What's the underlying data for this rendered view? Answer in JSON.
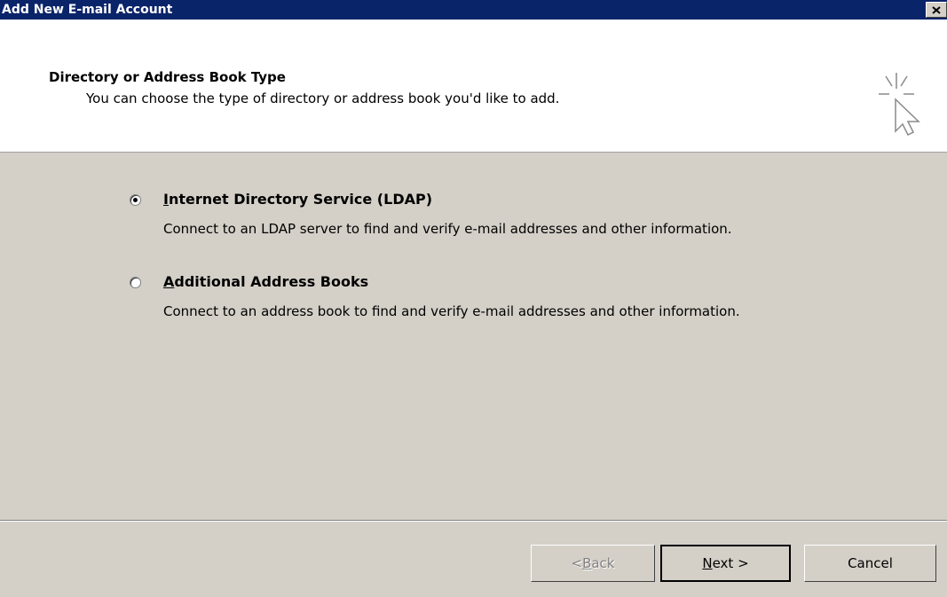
{
  "window": {
    "title": "Add New E-mail Account"
  },
  "header": {
    "title": "Directory or Address Book Type",
    "subtitle": "You can choose the type of directory or address book you'd like to add."
  },
  "options": [
    {
      "mnemonic": "I",
      "label_rest": "nternet Directory Service (LDAP)",
      "description": "Connect to an LDAP server to find and verify e-mail addresses and other information.",
      "selected": true
    },
    {
      "mnemonic": "A",
      "label_rest": "dditional Address Books",
      "description": "Connect to an address book to find and verify e-mail addresses and other information.",
      "selected": false
    }
  ],
  "buttons": {
    "back": {
      "prefix": "< ",
      "mnemonic": "B",
      "rest": "ack",
      "enabled": false
    },
    "next": {
      "mnemonic": "N",
      "rest": "ext >",
      "enabled": true
    },
    "cancel": {
      "label": "Cancel",
      "enabled": true
    }
  },
  "icons": {
    "close": "close-icon",
    "wizard": "wizard-cursor-icon"
  },
  "colors": {
    "titlebar": "#0a246a",
    "face": "#d4d0c8",
    "header_bg": "#ffffff"
  }
}
